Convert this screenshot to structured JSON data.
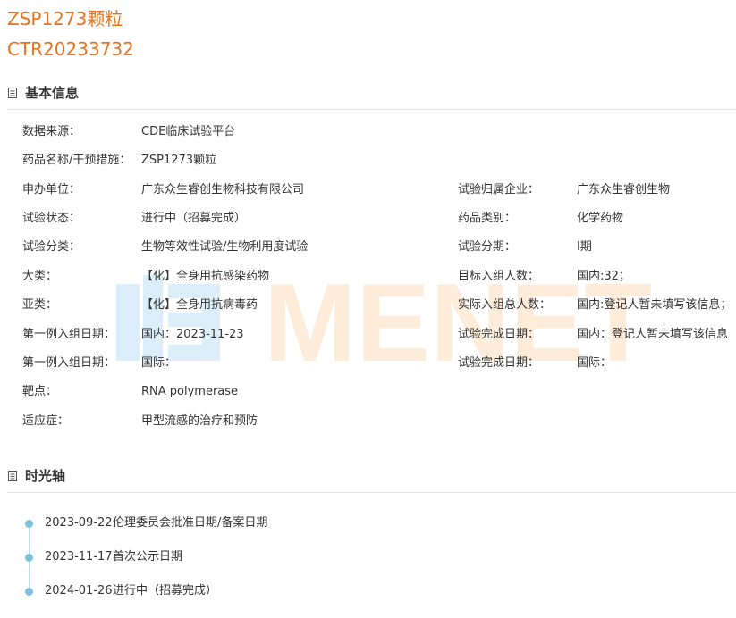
{
  "header": {
    "drug_name": "ZSP1273颗粒",
    "registration_no": "CTR20233732"
  },
  "sections": {
    "basic_info": {
      "title": "基本信息",
      "icon": "document-icon"
    },
    "timeline": {
      "title": "时光轴",
      "icon": "document-icon"
    }
  },
  "watermark": {
    "text": "MENET",
    "icon": "menet-logo-icon"
  },
  "info_rows": [
    {
      "label": "数据来源：",
      "value": "CDE临床试验平台"
    },
    {
      "label": "药品名称/干预措施：",
      "value": "ZSP1273颗粒"
    },
    {
      "label": "申办单位：",
      "value": "广东众生睿创生物科技有限公司",
      "label2": "试验归属企业：",
      "value2": "广东众生睿创生物"
    },
    {
      "label": "试验状态：",
      "value": "进行中（招募完成）",
      "label2": "药品类别：",
      "value2": "化学药物"
    },
    {
      "label": "试验分类：",
      "value": "生物等效性试验/生物利用度试验",
      "label2": "试验分期：",
      "value2": "I期"
    },
    {
      "label": "大类：",
      "value": "【化】全身用抗感染药物",
      "label2": "目标入组人数：",
      "value2": "国内:32；"
    },
    {
      "label": "亚类：",
      "value": "【化】全身用抗病毒药",
      "label2": "实际入组总人数：",
      "value2": "国内:登记人暂未填写该信息；"
    },
    {
      "label": "第一例入组日期：",
      "value": "国内：2023-11-23",
      "label2": "试验完成日期：",
      "value2": "国内：登记人暂未填写该信息"
    },
    {
      "label": "第一例入组日期：",
      "value": "国际：",
      "label2": "试验完成日期：",
      "value2": "国际："
    },
    {
      "label": "靶点：",
      "value": "RNA polymerase"
    },
    {
      "label": "适应症：",
      "value": "甲型流感的治疗和预防"
    }
  ],
  "timeline": [
    {
      "date": "2023-09-22",
      "text": "伦理委员会批准日期/备案日期"
    },
    {
      "date": "2023-11-17",
      "text": "首次公示日期"
    },
    {
      "date": "2024-01-26",
      "text": "进行中（招募完成）"
    }
  ],
  "colors": {
    "accent": "#e8721c",
    "timeline_dot": "#7fc0db",
    "watermark_blue": "#dceefa",
    "watermark_orange": "#fcecd9"
  }
}
